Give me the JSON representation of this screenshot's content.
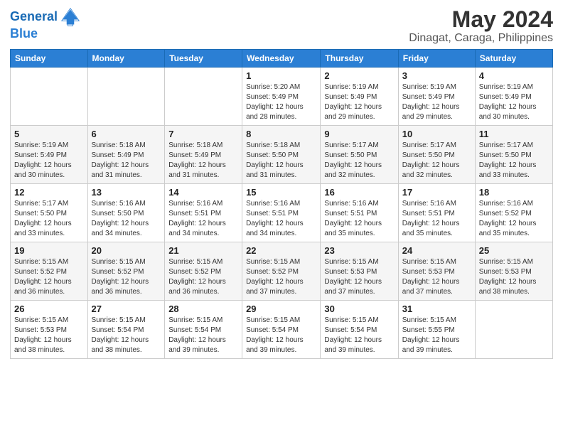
{
  "logo": {
    "line1": "General",
    "line2": "Blue"
  },
  "header": {
    "title": "May 2024",
    "subtitle": "Dinagat, Caraga, Philippines"
  },
  "days_of_week": [
    "Sunday",
    "Monday",
    "Tuesday",
    "Wednesday",
    "Thursday",
    "Friday",
    "Saturday"
  ],
  "weeks": [
    [
      {
        "day": "",
        "sunrise": "",
        "sunset": "",
        "daylight": ""
      },
      {
        "day": "",
        "sunrise": "",
        "sunset": "",
        "daylight": ""
      },
      {
        "day": "",
        "sunrise": "",
        "sunset": "",
        "daylight": ""
      },
      {
        "day": "1",
        "sunrise": "Sunrise: 5:20 AM",
        "sunset": "Sunset: 5:49 PM",
        "daylight": "Daylight: 12 hours and 28 minutes."
      },
      {
        "day": "2",
        "sunrise": "Sunrise: 5:19 AM",
        "sunset": "Sunset: 5:49 PM",
        "daylight": "Daylight: 12 hours and 29 minutes."
      },
      {
        "day": "3",
        "sunrise": "Sunrise: 5:19 AM",
        "sunset": "Sunset: 5:49 PM",
        "daylight": "Daylight: 12 hours and 29 minutes."
      },
      {
        "day": "4",
        "sunrise": "Sunrise: 5:19 AM",
        "sunset": "Sunset: 5:49 PM",
        "daylight": "Daylight: 12 hours and 30 minutes."
      }
    ],
    [
      {
        "day": "5",
        "sunrise": "Sunrise: 5:19 AM",
        "sunset": "Sunset: 5:49 PM",
        "daylight": "Daylight: 12 hours and 30 minutes."
      },
      {
        "day": "6",
        "sunrise": "Sunrise: 5:18 AM",
        "sunset": "Sunset: 5:49 PM",
        "daylight": "Daylight: 12 hours and 31 minutes."
      },
      {
        "day": "7",
        "sunrise": "Sunrise: 5:18 AM",
        "sunset": "Sunset: 5:49 PM",
        "daylight": "Daylight: 12 hours and 31 minutes."
      },
      {
        "day": "8",
        "sunrise": "Sunrise: 5:18 AM",
        "sunset": "Sunset: 5:50 PM",
        "daylight": "Daylight: 12 hours and 31 minutes."
      },
      {
        "day": "9",
        "sunrise": "Sunrise: 5:17 AM",
        "sunset": "Sunset: 5:50 PM",
        "daylight": "Daylight: 12 hours and 32 minutes."
      },
      {
        "day": "10",
        "sunrise": "Sunrise: 5:17 AM",
        "sunset": "Sunset: 5:50 PM",
        "daylight": "Daylight: 12 hours and 32 minutes."
      },
      {
        "day": "11",
        "sunrise": "Sunrise: 5:17 AM",
        "sunset": "Sunset: 5:50 PM",
        "daylight": "Daylight: 12 hours and 33 minutes."
      }
    ],
    [
      {
        "day": "12",
        "sunrise": "Sunrise: 5:17 AM",
        "sunset": "Sunset: 5:50 PM",
        "daylight": "Daylight: 12 hours and 33 minutes."
      },
      {
        "day": "13",
        "sunrise": "Sunrise: 5:16 AM",
        "sunset": "Sunset: 5:50 PM",
        "daylight": "Daylight: 12 hours and 34 minutes."
      },
      {
        "day": "14",
        "sunrise": "Sunrise: 5:16 AM",
        "sunset": "Sunset: 5:51 PM",
        "daylight": "Daylight: 12 hours and 34 minutes."
      },
      {
        "day": "15",
        "sunrise": "Sunrise: 5:16 AM",
        "sunset": "Sunset: 5:51 PM",
        "daylight": "Daylight: 12 hours and 34 minutes."
      },
      {
        "day": "16",
        "sunrise": "Sunrise: 5:16 AM",
        "sunset": "Sunset: 5:51 PM",
        "daylight": "Daylight: 12 hours and 35 minutes."
      },
      {
        "day": "17",
        "sunrise": "Sunrise: 5:16 AM",
        "sunset": "Sunset: 5:51 PM",
        "daylight": "Daylight: 12 hours and 35 minutes."
      },
      {
        "day": "18",
        "sunrise": "Sunrise: 5:16 AM",
        "sunset": "Sunset: 5:52 PM",
        "daylight": "Daylight: 12 hours and 35 minutes."
      }
    ],
    [
      {
        "day": "19",
        "sunrise": "Sunrise: 5:15 AM",
        "sunset": "Sunset: 5:52 PM",
        "daylight": "Daylight: 12 hours and 36 minutes."
      },
      {
        "day": "20",
        "sunrise": "Sunrise: 5:15 AM",
        "sunset": "Sunset: 5:52 PM",
        "daylight": "Daylight: 12 hours and 36 minutes."
      },
      {
        "day": "21",
        "sunrise": "Sunrise: 5:15 AM",
        "sunset": "Sunset: 5:52 PM",
        "daylight": "Daylight: 12 hours and 36 minutes."
      },
      {
        "day": "22",
        "sunrise": "Sunrise: 5:15 AM",
        "sunset": "Sunset: 5:52 PM",
        "daylight": "Daylight: 12 hours and 37 minutes."
      },
      {
        "day": "23",
        "sunrise": "Sunrise: 5:15 AM",
        "sunset": "Sunset: 5:53 PM",
        "daylight": "Daylight: 12 hours and 37 minutes."
      },
      {
        "day": "24",
        "sunrise": "Sunrise: 5:15 AM",
        "sunset": "Sunset: 5:53 PM",
        "daylight": "Daylight: 12 hours and 37 minutes."
      },
      {
        "day": "25",
        "sunrise": "Sunrise: 5:15 AM",
        "sunset": "Sunset: 5:53 PM",
        "daylight": "Daylight: 12 hours and 38 minutes."
      }
    ],
    [
      {
        "day": "26",
        "sunrise": "Sunrise: 5:15 AM",
        "sunset": "Sunset: 5:53 PM",
        "daylight": "Daylight: 12 hours and 38 minutes."
      },
      {
        "day": "27",
        "sunrise": "Sunrise: 5:15 AM",
        "sunset": "Sunset: 5:54 PM",
        "daylight": "Daylight: 12 hours and 38 minutes."
      },
      {
        "day": "28",
        "sunrise": "Sunrise: 5:15 AM",
        "sunset": "Sunset: 5:54 PM",
        "daylight": "Daylight: 12 hours and 39 minutes."
      },
      {
        "day": "29",
        "sunrise": "Sunrise: 5:15 AM",
        "sunset": "Sunset: 5:54 PM",
        "daylight": "Daylight: 12 hours and 39 minutes."
      },
      {
        "day": "30",
        "sunrise": "Sunrise: 5:15 AM",
        "sunset": "Sunset: 5:54 PM",
        "daylight": "Daylight: 12 hours and 39 minutes."
      },
      {
        "day": "31",
        "sunrise": "Sunrise: 5:15 AM",
        "sunset": "Sunset: 5:55 PM",
        "daylight": "Daylight: 12 hours and 39 minutes."
      },
      {
        "day": "",
        "sunrise": "",
        "sunset": "",
        "daylight": ""
      }
    ]
  ]
}
